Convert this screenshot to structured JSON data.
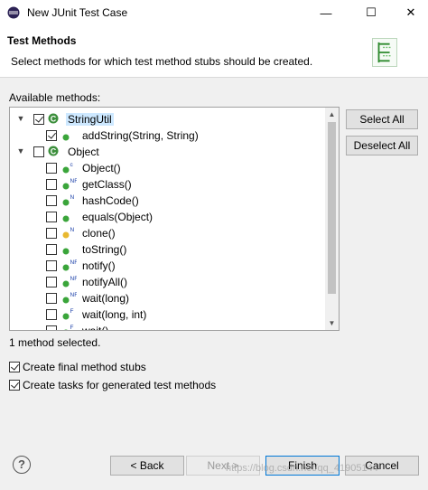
{
  "window": {
    "title": "New JUnit Test Case",
    "min_glyph": "—",
    "max_glyph": "☐",
    "close_glyph": "✕"
  },
  "header": {
    "title": "Test Methods",
    "description": "Select methods for which test method stubs should be created.",
    "icon": "junit-wizard-icon"
  },
  "available_label": "Available methods:",
  "tree": [
    {
      "label": "StringUtil",
      "level": 0,
      "expanded": true,
      "checked": true,
      "icon": "class-icon",
      "overlay": "",
      "selected": true
    },
    {
      "label": "addString(String, String)",
      "level": 1,
      "checked": true,
      "icon": "method-public-icon",
      "overlay": ""
    },
    {
      "label": "Object",
      "level": 0,
      "expanded": true,
      "checked": false,
      "icon": "class-icon",
      "overlay": ""
    },
    {
      "label": "Object()",
      "level": 1,
      "checked": false,
      "icon": "method-public-icon",
      "overlay": "c"
    },
    {
      "label": "getClass()",
      "level": 1,
      "checked": false,
      "icon": "method-public-icon",
      "overlay": "NF"
    },
    {
      "label": "hashCode()",
      "level": 1,
      "checked": false,
      "icon": "method-public-icon",
      "overlay": "N"
    },
    {
      "label": "equals(Object)",
      "level": 1,
      "checked": false,
      "icon": "method-public-icon",
      "overlay": ""
    },
    {
      "label": "clone()",
      "level": 1,
      "checked": false,
      "icon": "method-protected-icon",
      "overlay": "N"
    },
    {
      "label": "toString()",
      "level": 1,
      "checked": false,
      "icon": "method-public-icon",
      "overlay": ""
    },
    {
      "label": "notify()",
      "level": 1,
      "checked": false,
      "icon": "method-public-icon",
      "overlay": "NF"
    },
    {
      "label": "notifyAll()",
      "level": 1,
      "checked": false,
      "icon": "method-public-icon",
      "overlay": "NF"
    },
    {
      "label": "wait(long)",
      "level": 1,
      "checked": false,
      "icon": "method-public-icon",
      "overlay": "NF"
    },
    {
      "label": "wait(long, int)",
      "level": 1,
      "checked": false,
      "icon": "method-public-icon",
      "overlay": "F"
    },
    {
      "label": "wait()",
      "level": 1,
      "checked": false,
      "icon": "method-public-icon",
      "overlay": "F"
    }
  ],
  "side_buttons": {
    "select_all": "Select All",
    "deselect_all": "Deselect All"
  },
  "status": "1 method selected.",
  "options": [
    {
      "label": "Create final method stubs",
      "checked": true
    },
    {
      "label": "Create tasks for generated test methods",
      "checked": true
    }
  ],
  "footer": {
    "help": "?",
    "back": "< Back",
    "next": "Next >",
    "finish": "Finish",
    "cancel": "Cancel"
  },
  "watermark": "https://blog.csdn.net/qq_41905144",
  "colors": {
    "selection": "#cde8ff",
    "method_public": "#3aa53a",
    "method_protected": "#e8b830",
    "class_icon": "#3c8f3c"
  }
}
